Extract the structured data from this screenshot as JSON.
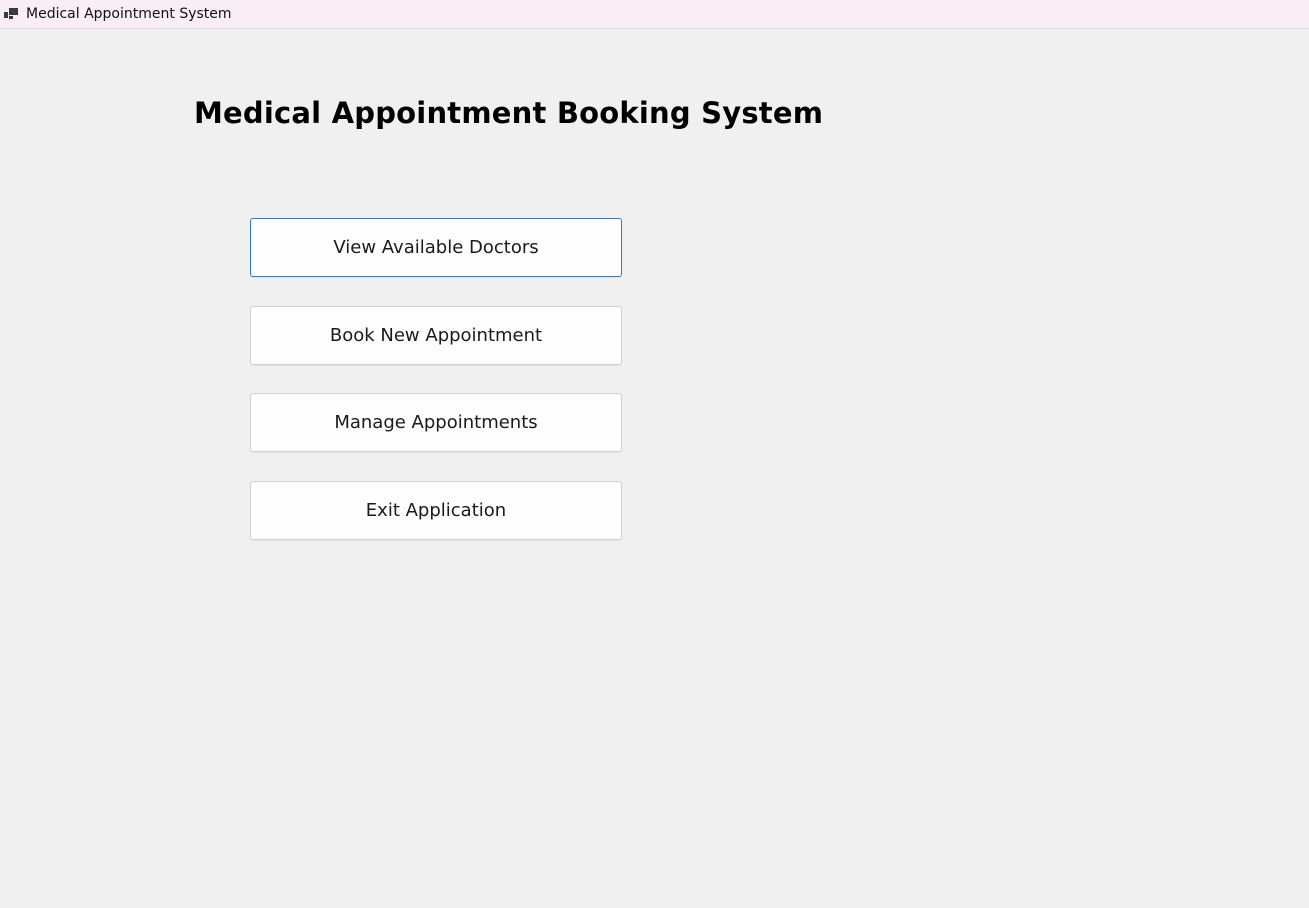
{
  "window": {
    "title": "Medical Appointment System",
    "icon": "app-window-icon"
  },
  "main": {
    "heading": "Medical Appointment Booking System",
    "buttons": [
      {
        "label": "View Available Doctors",
        "focused": true
      },
      {
        "label": "Book New Appointment",
        "focused": false
      },
      {
        "label": "Manage Appointments",
        "focused": false
      },
      {
        "label": "Exit Application",
        "focused": false
      }
    ]
  },
  "colors": {
    "titlebar_bg": "#f9eef3",
    "window_bg": "#f0f0f0",
    "button_bg": "#fdfdfd",
    "focus_border": "#2a7fc9"
  }
}
